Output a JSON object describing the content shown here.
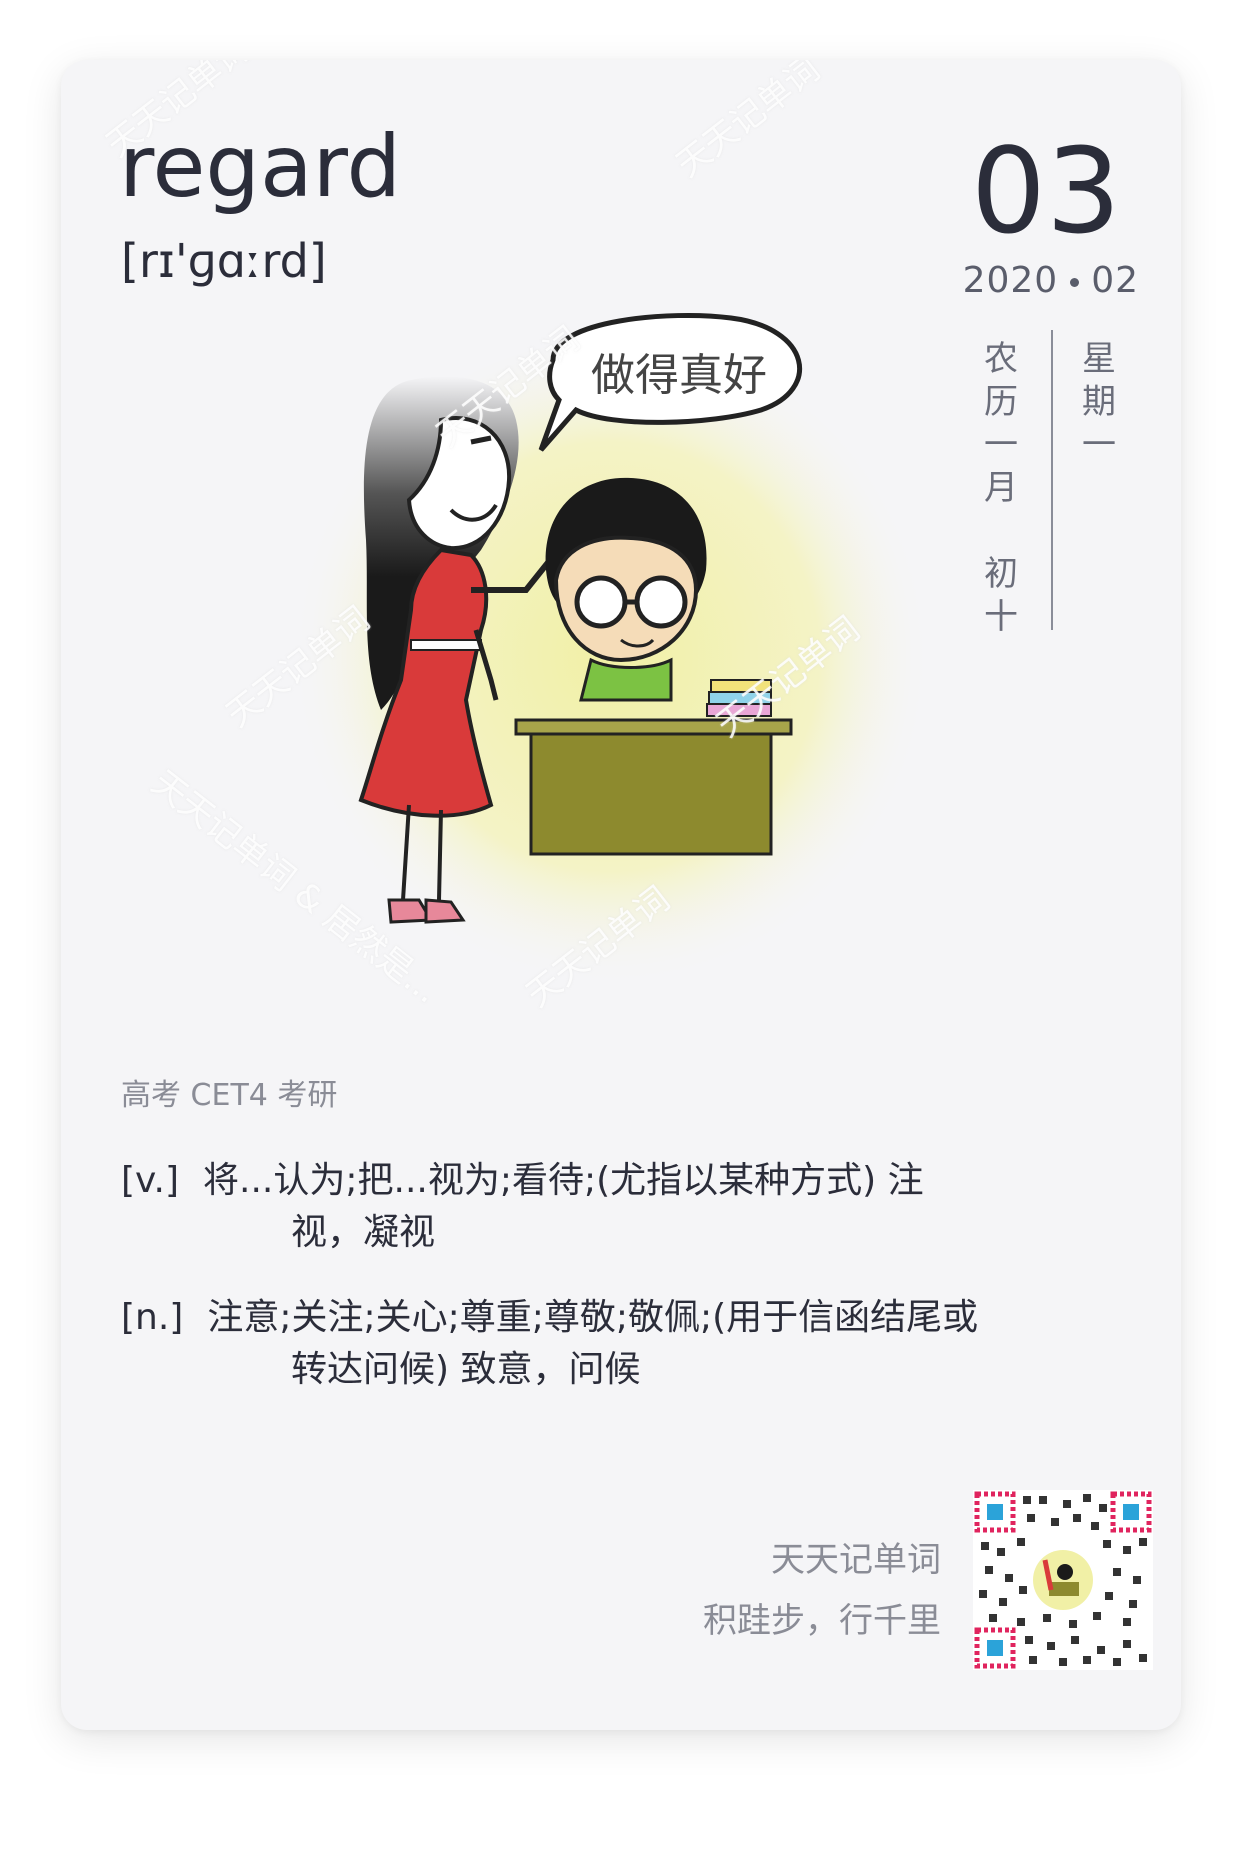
{
  "word": "regard",
  "phonetic": "[rɪ'ɡɑːrd]",
  "date": {
    "day": "03",
    "year": "2020",
    "month": "02",
    "lunar": [
      "农",
      "历",
      "一",
      "月",
      "",
      "初",
      "十"
    ],
    "weekday": [
      "星",
      "期",
      "一"
    ]
  },
  "illustration": {
    "speech_bubble": "做得真好"
  },
  "tags": "高考 CET4 考研",
  "definitions": [
    {
      "pos": "[v.]",
      "line1": "将...认为;把...视为;看待;(尤指以某种方式) 注",
      "line2": "视，凝视"
    },
    {
      "pos": "[n.]",
      "line1": "注意;关注;关心;尊重;尊敬;敬佩;(用于信函结尾或",
      "line2": "转达问候) 致意，问候"
    }
  ],
  "brand": {
    "name": "天天记单词",
    "slogan": "积跬步，行千里"
  },
  "watermarks": [
    "天天记单词",
    "天天记单词",
    "天天记单词",
    "天天记单词",
    "天天记单词",
    "天天记单词 & 居然是...",
    "天天记单词"
  ],
  "colors": {
    "card_bg": "#f5f5f7",
    "text": "#2b2d3a",
    "muted": "#8a8c96",
    "dress": "#d93a3a",
    "shirt": "#7cc243",
    "desk": "#8d8a2e",
    "glow": "#f4f2b0"
  }
}
